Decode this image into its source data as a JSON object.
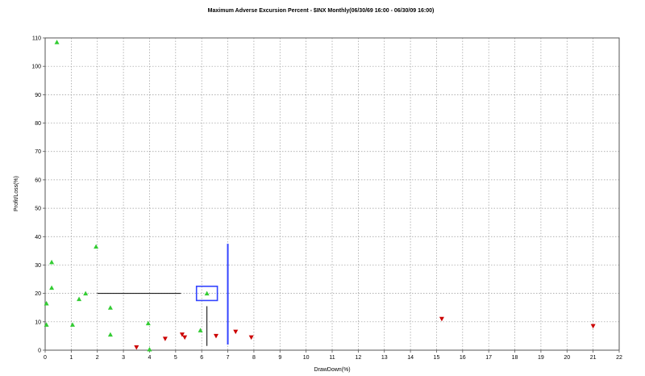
{
  "chart_data": {
    "type": "scatter",
    "title": "Maximum Adverse Excursion Percent - $INX Monthly(06/30/69 16:00 - 06/30/09 16:00)",
    "xlabel": "DrawDown(%)",
    "ylabel": "Profit/Loss(%)",
    "xlim": [
      0,
      22
    ],
    "ylim": [
      0,
      110
    ],
    "x_ticks": [
      0,
      1,
      2,
      3,
      4,
      5,
      6,
      7,
      8,
      9,
      10,
      11,
      12,
      13,
      14,
      15,
      16,
      17,
      18,
      19,
      20,
      21,
      22
    ],
    "y_ticks": [
      0,
      10,
      20,
      30,
      40,
      50,
      60,
      70,
      80,
      90,
      100,
      110
    ],
    "grid": true,
    "series": [
      {
        "marker": "triangle-up",
        "color": "#33cc33",
        "points": [
          [
            0.45,
            108.5
          ],
          [
            0.05,
            16.5
          ],
          [
            0.05,
            9.0
          ],
          [
            0.25,
            31.0
          ],
          [
            0.25,
            22.0
          ],
          [
            1.05,
            9.0
          ],
          [
            1.3,
            18.0
          ],
          [
            1.55,
            20.0
          ],
          [
            1.95,
            36.5
          ],
          [
            2.5,
            15.0
          ],
          [
            2.5,
            5.5
          ],
          [
            3.95,
            9.5
          ],
          [
            4.0,
            0.3
          ],
          [
            5.95,
            7.0
          ],
          [
            6.2,
            20.0
          ]
        ]
      },
      {
        "marker": "triangle-down",
        "color": "#cc0000",
        "points": [
          [
            3.5,
            1.0
          ],
          [
            4.6,
            4.0
          ],
          [
            5.25,
            5.5
          ],
          [
            5.35,
            4.5
          ],
          [
            6.55,
            5.0
          ],
          [
            7.3,
            6.5
          ],
          [
            7.9,
            4.5
          ],
          [
            15.2,
            11.0
          ],
          [
            21.0,
            8.5
          ]
        ]
      }
    ],
    "annotations": [
      {
        "type": "line",
        "color": "#000000",
        "from": [
          2.0,
          20.0
        ],
        "to": [
          5.2,
          20.0
        ]
      },
      {
        "type": "line",
        "color": "#000000",
        "from": [
          6.2,
          15.5
        ],
        "to": [
          6.2,
          1.5
        ]
      },
      {
        "type": "line",
        "color": "#3344ff",
        "from": [
          7.0,
          37.5
        ],
        "to": [
          7.0,
          2.0
        ]
      },
      {
        "type": "rect",
        "color": "#3344ff",
        "x": [
          5.8,
          6.6
        ],
        "y": [
          17.5,
          22.5
        ]
      }
    ]
  }
}
